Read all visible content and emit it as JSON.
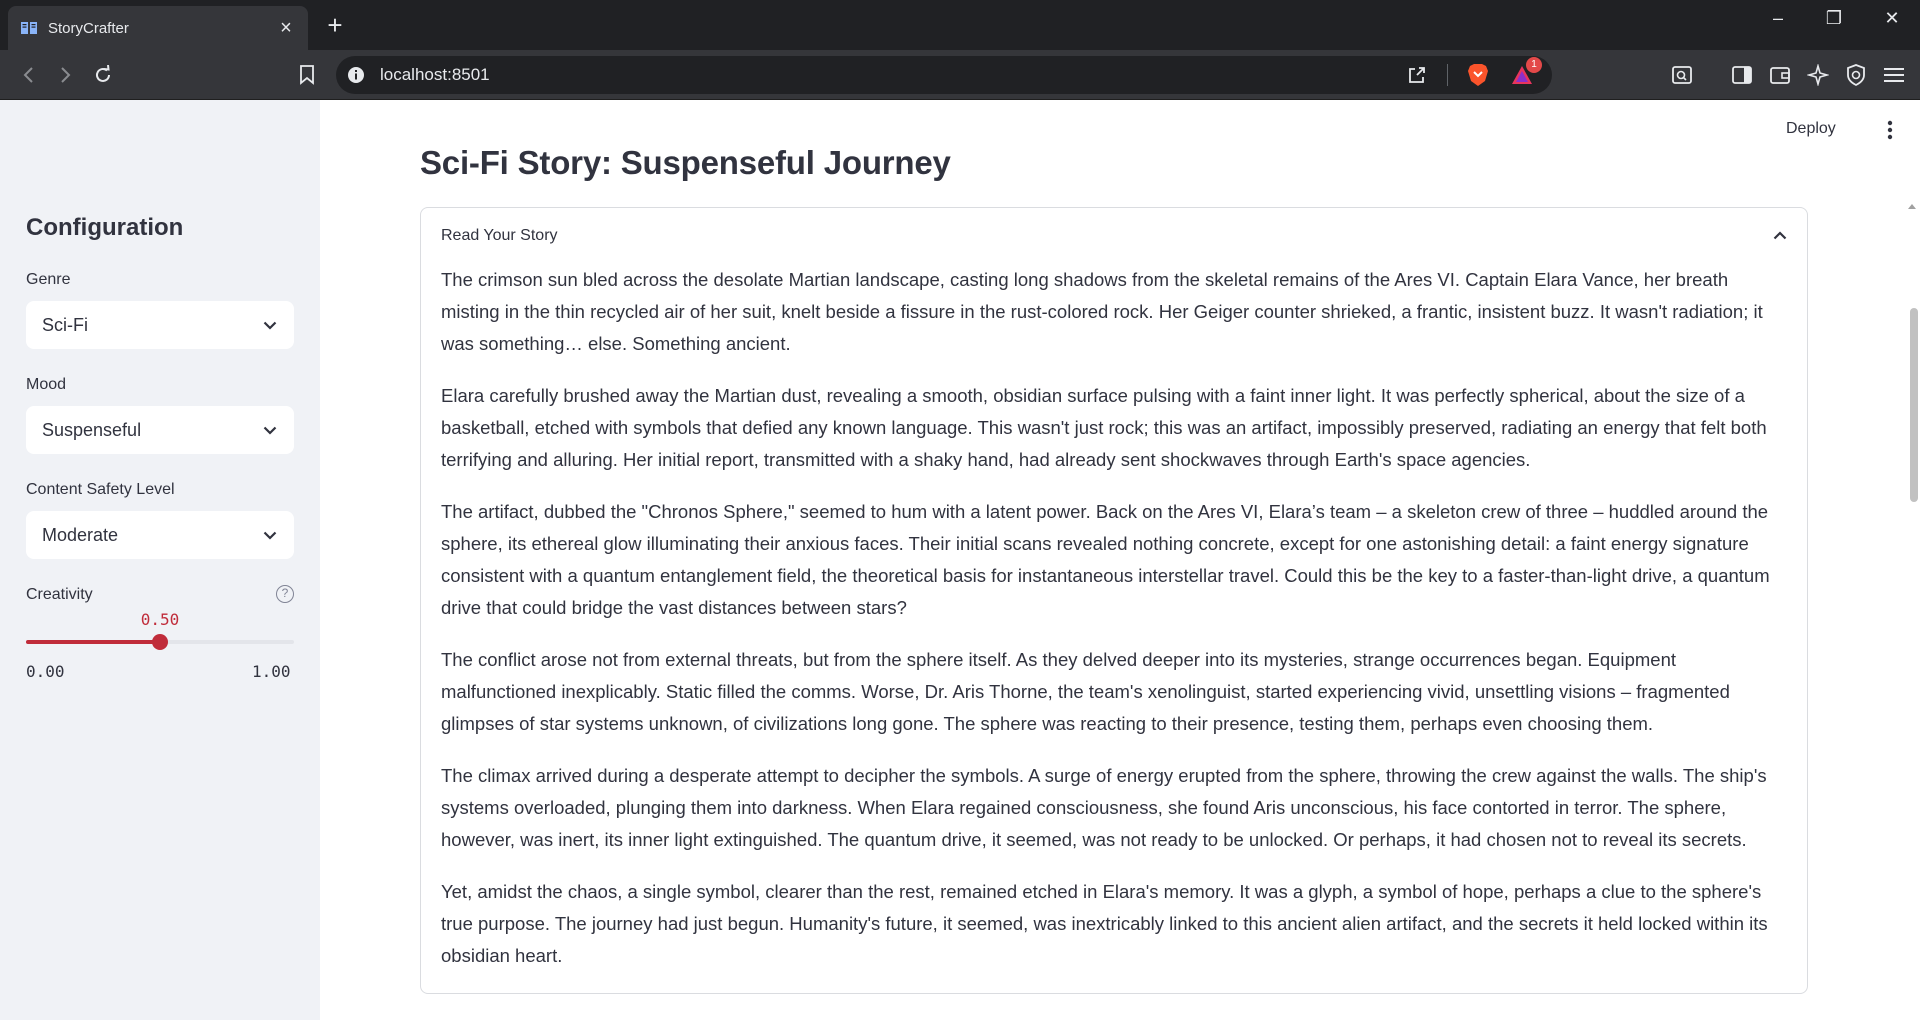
{
  "browser": {
    "tab_title": "StoryCrafter",
    "url": "localhost:8501",
    "notification_count": "1"
  },
  "app": {
    "deploy_label": "Deploy",
    "page_title": "Sci-Fi Story: Suspenseful Journey"
  },
  "sidebar": {
    "title": "Configuration",
    "genre": {
      "label": "Genre",
      "value": "Sci-Fi"
    },
    "mood": {
      "label": "Mood",
      "value": "Suspenseful"
    },
    "safety": {
      "label": "Content Safety Level",
      "value": "Moderate"
    },
    "creativity": {
      "label": "Creativity",
      "help_icon": "?",
      "value": 0.5,
      "value_label": "0.50",
      "min_label": "0.00",
      "max_label": "1.00"
    }
  },
  "expander": {
    "label": "Read Your Story",
    "expanded": true
  },
  "story": {
    "paragraphs": [
      "The crimson sun bled across the desolate Martian landscape, casting long shadows from the skeletal remains of the Ares VI. Captain Elara Vance, her breath misting in the thin recycled air of her suit, knelt beside a fissure in the rust-colored rock. Her Geiger counter shrieked, a frantic, insistent buzz. It wasn't radiation; it was something… else. Something ancient.",
      "Elara carefully brushed away the Martian dust, revealing a smooth, obsidian surface pulsing with a faint inner light. It was perfectly spherical, about the size of a basketball, etched with symbols that defied any known language. This wasn't just rock; this was an artifact, impossibly preserved, radiating an energy that felt both terrifying and alluring. Her initial report, transmitted with a shaky hand, had already sent shockwaves through Earth's space agencies.",
      "The artifact, dubbed the \"Chronos Sphere,\" seemed to hum with a latent power. Back on the Ares VI, Elara’s team – a skeleton crew of three – huddled around the sphere, its ethereal glow illuminating their anxious faces. Their initial scans revealed nothing concrete, except for one astonishing detail: a faint energy signature consistent with a quantum entanglement field, the theoretical basis for instantaneous interstellar travel. Could this be the key to a faster-than-light drive, a quantum drive that could bridge the vast distances between stars?",
      "The conflict arose not from external threats, but from the sphere itself. As they delved deeper into its mysteries, strange occurrences began. Equipment malfunctioned inexplicably. Static filled the comms. Worse, Dr. Aris Thorne, the team's xenolinguist, started experiencing vivid, unsettling visions – fragmented glimpses of star systems unknown, of civilizations long gone. The sphere was reacting to their presence, testing them, perhaps even choosing them.",
      "The climax arrived during a desperate attempt to decipher the symbols. A surge of energy erupted from the sphere, throwing the crew against the walls. The ship's systems overloaded, plunging them into darkness. When Elara regained consciousness, she found Aris unconscious, his face contorted in terror. The sphere, however, was inert, its inner light extinguished. The quantum drive, it seemed, was not ready to be unlocked. Or perhaps, it had chosen not to reveal its secrets.",
      "Yet, amidst the chaos, a single symbol, clearer than the rest, remained etched in Elara's memory. It was a glyph, a symbol of hope, perhaps a clue to the sphere's true purpose. The journey had just begun. Humanity's future, it seemed, was inextricably linked to this ancient alien artifact, and the secrets it held locked within its obsidian heart."
    ]
  },
  "colors": {
    "accent": "#c02c3a",
    "sidebar_bg": "#f0f2f6",
    "text": "#31333f",
    "browser_dark": "#202124",
    "browser_toolbar": "#35363a"
  },
  "icons": [
    "book-icon",
    "close-icon",
    "plus-icon",
    "minimize-icon",
    "restore-icon",
    "window-close-icon",
    "back-icon",
    "forward-icon",
    "reload-icon",
    "bookmark-icon",
    "info-icon",
    "share-icon",
    "brave-lion-icon",
    "brave-rewards-icon",
    "screenshot-icon",
    "sidebar-icon",
    "wallet-icon",
    "leo-ai-icon",
    "vpn-shield-icon",
    "menu-icon",
    "kebab-icon",
    "chevron-down-icon",
    "chevron-up-icon",
    "help-icon"
  ]
}
